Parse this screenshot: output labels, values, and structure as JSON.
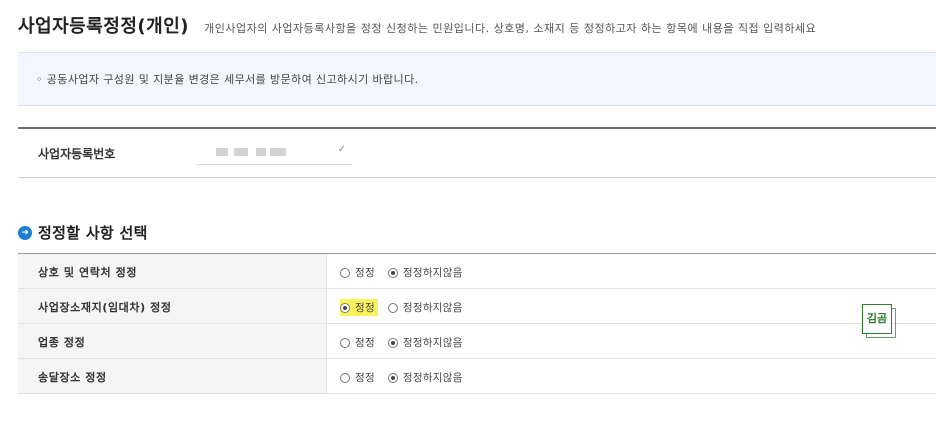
{
  "header": {
    "title": "사업자등록정정(개인)",
    "description": "개인사업자의 사업자등록사항을 정정 신청하는 민원입니다. 상호명, 소재지 등 정정하고자 하는 항목에 내용을 직접 입력하세요"
  },
  "notice": {
    "text": "◦ 공동사업자 구성원 및 지분율 변경은 세무서를 방문하여 신고하시기 바랍니다."
  },
  "bizno": {
    "label": "사업자등록번호"
  },
  "section": {
    "title": "정정할 사항 선택"
  },
  "options": [
    {
      "label": "상호 및 연락처 정정",
      "opt_yes": "정정",
      "opt_no": "정정하지않음",
      "selected": "no"
    },
    {
      "label": "사업장소재지(임대차) 정정",
      "opt_yes": "정정",
      "opt_no": "정정하지않음",
      "selected": "yes"
    },
    {
      "label": "업종 정정",
      "opt_yes": "정정",
      "opt_no": "정정하지않음",
      "selected": "no"
    },
    {
      "label": "송달장소 정정",
      "opt_yes": "정정",
      "opt_no": "정정하지않음",
      "selected": "no"
    }
  ],
  "stamp": {
    "text": "김곰"
  },
  "colors": {
    "section_bullet": "#1a7ed0",
    "highlight": "#fbf15a",
    "stamp": "#2e7d32"
  }
}
